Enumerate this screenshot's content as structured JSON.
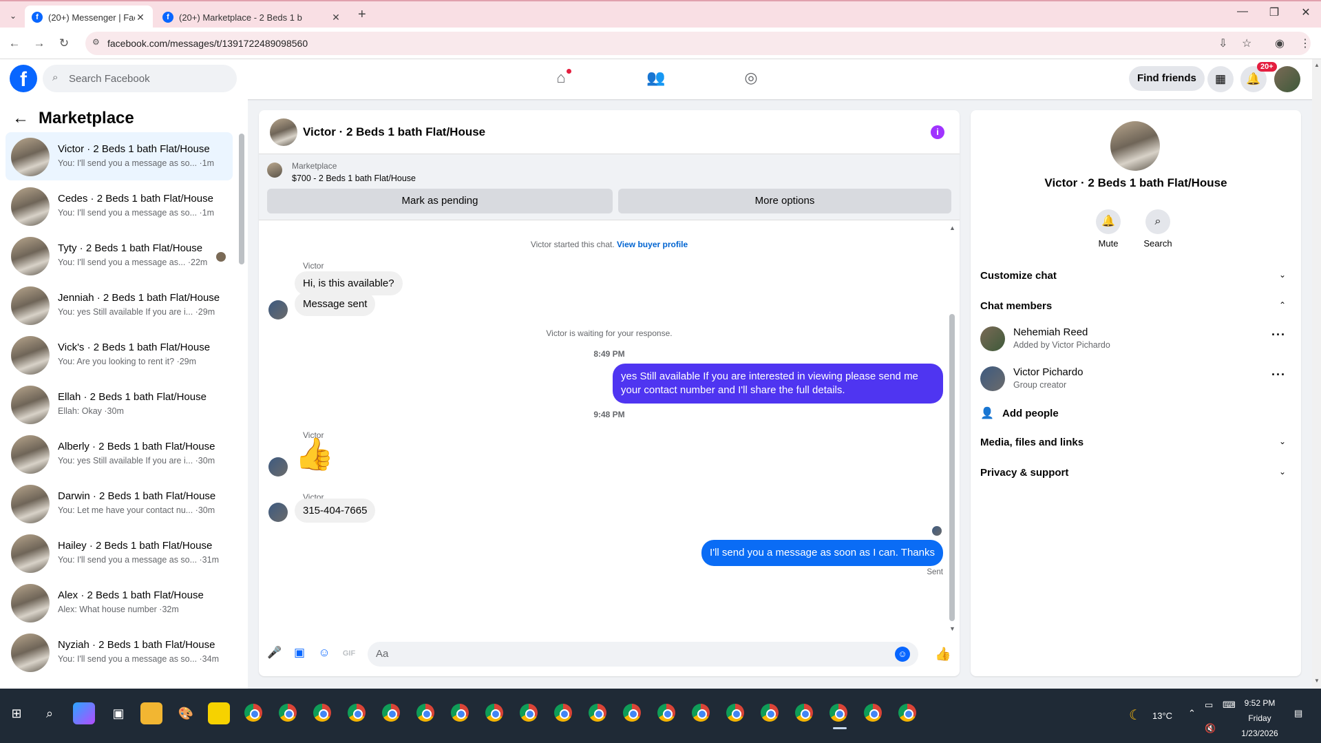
{
  "browser": {
    "tabs": [
      {
        "label": "(20+) Messenger | Facebook",
        "active": true
      },
      {
        "label": "(20+) Marketplace - 2 Beds 1 b",
        "active": false
      }
    ],
    "url": "facebook.com/messages/t/1391722489098560"
  },
  "header": {
    "search_placeholder": "Search Facebook",
    "find_friends": "Find friends",
    "notifications_badge": "20+"
  },
  "sidebar": {
    "title": "Marketplace",
    "conversations": [
      {
        "name": "Victor · 2 Beds 1 bath Flat/House",
        "preview": "You: I'll send you a message as so... ·1m",
        "active": true
      },
      {
        "name": "Cedes · 2 Beds 1 bath Flat/House",
        "preview": "You: I'll send you a message as so... ·1m"
      },
      {
        "name": "Tyty · 2 Beds 1 bath Flat/House",
        "preview": "You: I'll send you a message as... ·22m"
      },
      {
        "name": "Jenniah · 2 Beds 1 bath Flat/House",
        "preview": "You: yes Still available If you are i... ·29m"
      },
      {
        "name": "Vick's · 2 Beds 1 bath Flat/House",
        "preview": "You: Are you looking to rent it? ·29m"
      },
      {
        "name": "Ellah · 2 Beds 1 bath Flat/House",
        "preview": "Ellah: Okay ·30m"
      },
      {
        "name": "Alberly · 2 Beds 1 bath Flat/House",
        "preview": "You: yes Still available If you are i... ·30m"
      },
      {
        "name": "Darwin · 2 Beds 1 bath Flat/House",
        "preview": "You: Let me have your contact nu... ·30m"
      },
      {
        "name": "Hailey · 2 Beds 1 bath Flat/House",
        "preview": "You: I'll send you a message as so... ·31m"
      },
      {
        "name": "Alex · 2 Beds 1 bath Flat/House",
        "preview": "Alex: What house number ·32m"
      },
      {
        "name": "Nyziah · 2 Beds 1 bath Flat/House",
        "preview": "You: I'll send you a message as so... ·34m"
      }
    ]
  },
  "chat": {
    "title": "Victor · 2 Beds 1 bath Flat/House",
    "marketplace_label": "Marketplace",
    "listing": "$700 - 2 Beds 1 bath Flat/House",
    "mark_pending": "Mark as pending",
    "more_options": "More options",
    "started": "Victor started this chat.",
    "view_buyer": "View buyer profile",
    "sender": "Victor",
    "msg1": "Hi, is this available?",
    "msg2": "Message sent",
    "waiting": "Victor is waiting for your response.",
    "time1": "8:49 PM",
    "out1": "yes Still available If you are interested in viewing please send me your contact number and I'll share the full details.",
    "time2": "9:48 PM",
    "phone": "315-404-7665",
    "out2": "I'll send you a message as soon as I can. Thanks",
    "sent": "Sent",
    "composer_placeholder": "Aa"
  },
  "details": {
    "title": "Victor · 2 Beds 1 bath Flat/House",
    "mute": "Mute",
    "search": "Search",
    "customize": "Customize chat",
    "members_header": "Chat members",
    "members": [
      {
        "name": "Nehemiah Reed",
        "sub": "Added by Victor Pichardo"
      },
      {
        "name": "Victor Pichardo",
        "sub": "Group creator"
      }
    ],
    "add_people": "Add people",
    "media": "Media, files and links",
    "privacy": "Privacy & support"
  },
  "taskbar": {
    "weather": "13°C",
    "time": "9:52 PM",
    "day": "Friday",
    "date": "1/23/2026"
  }
}
